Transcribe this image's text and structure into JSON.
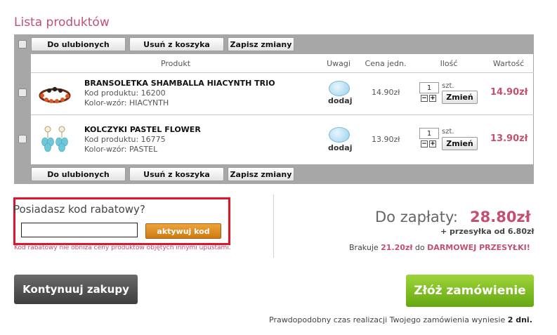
{
  "page": {
    "title": "Lista produktów"
  },
  "toolbar": {
    "favorites_label": "Do ulubionych",
    "remove_label": "Usuń z koszyka",
    "save_label": "Zapisz zmiany"
  },
  "columns": {
    "product": "Produkt",
    "notes": "Uwagi",
    "unit_price": "Cena jedn.",
    "quantity": "Ilość",
    "value": "Wartość"
  },
  "items": [
    {
      "name": "BRANSOLETKA SHAMBALLA HIACYNTH TRIO",
      "code_line": "Kod produktu: 16200",
      "color_line": "Kolor-wzór: HIACYNTH",
      "notes_action": "dodaj",
      "unit_price": "14.90zł",
      "quantity": "1",
      "unit": "szt.",
      "update_label": "Zmień",
      "value": "14.90zł",
      "image_icon": "bracelet-icon"
    },
    {
      "name": "KOLCZYKI PASTEL FLOWER",
      "code_line": "Kod produktu: 16775",
      "color_line": "Kolor-wzór: PASTEL",
      "notes_action": "dodaj",
      "unit_price": "13.90zł",
      "quantity": "1",
      "unit": "szt.",
      "update_label": "Zmień",
      "value": "13.90zł",
      "image_icon": "earrings-icon"
    }
  ],
  "promo": {
    "question": "Posiadasz kod rabatowy?",
    "input_value": "",
    "button_label": "aktywuj kod",
    "note": "Kod rabatowy nie obniża ceny produktów objętych innymi upustami."
  },
  "summary": {
    "total_label": "Do zapłaty:",
    "total_value": "28.80zł",
    "shipping": "+ przesyłka od 6.80zł",
    "missing_prefix": "Brakuje",
    "missing_amount": "21.20zł",
    "missing_middle": "do",
    "missing_target": "DARMOWEJ PRZESYŁKI!"
  },
  "actions": {
    "continue_label": "Kontynuuj zakupy",
    "order_label": "Złóż zamówienie"
  },
  "footer": {
    "realization_text": "Prawdopodobny czas realizacji Twojego zamówienia wyniesie",
    "realization_days": "2 dni."
  },
  "colors": {
    "accent": "#c2506f",
    "toolbar_bg": "#a7a7a7",
    "order_button": "#7cbc1e",
    "promo_button": "#e0952c",
    "highlight_border": "#e0142b"
  }
}
